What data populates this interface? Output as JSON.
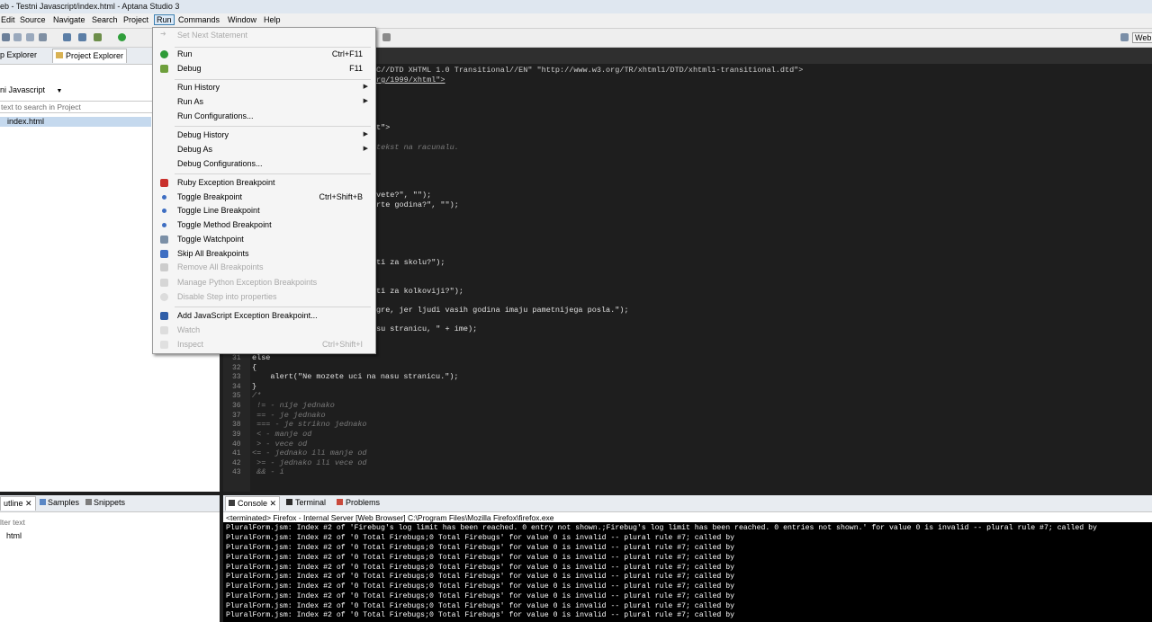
{
  "window": {
    "title": "eb - Testni Javascript/index.html - Aptana Studio 3"
  },
  "menubar": {
    "items": [
      "Edit",
      "Source",
      "Navigate",
      "Search",
      "Project",
      "Run",
      "Commands",
      "Window",
      "Help"
    ],
    "active": "Run"
  },
  "toolbar": {
    "web_label": "Web"
  },
  "left_panel": {
    "tabs": [
      "p Explorer",
      "Project Explorer"
    ],
    "project_selector": "ni Javascript",
    "search_placeholder": "text to search in Project",
    "tree": [
      {
        "label": "index.html",
        "selected": true
      }
    ]
  },
  "outline_panel": {
    "tabs": [
      "utline",
      "Samples",
      "Snippets"
    ],
    "filter_placeholder": "lter text",
    "tree": [
      {
        "label": "html"
      }
    ]
  },
  "editor": {
    "top_lines": [
      "C//DTD XHTML 1.0 Transitional//EN\" \"http://www.w3.org/TR/xhtml1/DTD/xhtml1-transitional.dtd\">",
      "rg/1999/xhtml\">"
    ],
    "mid_lines": [
      {
        "text": "t\">",
        "dim": false
      },
      {
        "text": "tekst na racunalu.",
        "dim": true
      },
      {
        "text": "vete?\", \"\");",
        "dim": false
      },
      {
        "text": "rte godina?\", \"\");",
        "dim": false
      },
      {
        "text": "ti za skolu?\");",
        "dim": false
      },
      {
        "text": "ti za kolkoviji?\");",
        "dim": false
      },
      {
        "text": "gre, jer ljudi vasih godina imaju pametnijega posla.\");",
        "dim": false
      },
      {
        "text": "su stranicu, \" + ime);",
        "dim": false
      }
    ],
    "numbered_lines": [
      {
        "n": "31",
        "text": "else",
        "dim": false
      },
      {
        "n": "32",
        "text": "{",
        "dim": false
      },
      {
        "n": "33",
        "text": "    alert(\"Ne mozete uci na nasu stranicu.\");",
        "dim": false
      },
      {
        "n": "34",
        "text": "}",
        "dim": false
      },
      {
        "n": "35",
        "text": "/*",
        "dim": true
      },
      {
        "n": "36",
        "text": " != - nije jednako",
        "dim": true
      },
      {
        "n": "37",
        "text": " == - je jednako",
        "dim": true
      },
      {
        "n": "38",
        "text": " === - je strikno jednako",
        "dim": true
      },
      {
        "n": "39",
        "text": " < - manje od",
        "dim": true
      },
      {
        "n": "40",
        "text": " > - vece od",
        "dim": true
      },
      {
        "n": "41",
        "text": "<= - jednako ili manje od",
        "dim": true
      },
      {
        "n": "42",
        "text": " >= - jednako ili vece od",
        "dim": true
      },
      {
        "n": "43",
        "text": " && - i",
        "dim": true
      }
    ]
  },
  "console": {
    "tabs": [
      "Console",
      "Terminal",
      "Problems"
    ],
    "header": "<terminated> Firefox - Internal Server [Web Browser] C:\\Program Files\\Mozilla Firefox\\firefox.exe",
    "first_line": "PluralForm.jsm: Index #2 of 'Firebug's log limit has been reached. 0 entry not shown.;Firebug's log limit has been reached. 0 entries not shown.' for value 0 is invalid -- plural rule #7; called by",
    "repeat_line": "PluralForm.jsm: Index #2 of '0 Total Firebugs;0 Total Firebugs' for value 0 is invalid -- plural rule #7; called by",
    "repeat_count": 9
  },
  "run_menu": {
    "items": [
      {
        "label": "Set Next Statement",
        "shortcut": "",
        "disabled": true,
        "submenu": false,
        "icon": "arrow-icon"
      },
      {
        "sep": true
      },
      {
        "label": "Run",
        "shortcut": "Ctrl+F11",
        "disabled": false,
        "submenu": false,
        "icon": "run-icon"
      },
      {
        "label": "Debug",
        "shortcut": "F11",
        "disabled": false,
        "submenu": false,
        "icon": "debug-icon"
      },
      {
        "sep": true
      },
      {
        "label": "Run History",
        "shortcut": "",
        "disabled": false,
        "submenu": true
      },
      {
        "label": "Run As",
        "shortcut": "",
        "disabled": false,
        "submenu": true
      },
      {
        "label": "Run Configurations...",
        "shortcut": "",
        "disabled": false,
        "submenu": false
      },
      {
        "sep": true
      },
      {
        "label": "Debug History",
        "shortcut": "",
        "disabled": false,
        "submenu": true
      },
      {
        "label": "Debug As",
        "shortcut": "",
        "disabled": false,
        "submenu": true
      },
      {
        "label": "Debug Configurations...",
        "shortcut": "",
        "disabled": false,
        "submenu": false
      },
      {
        "sep": true
      },
      {
        "label": "Ruby Exception Breakpoint",
        "shortcut": "",
        "disabled": false,
        "submenu": false,
        "icon": "breakpoint-icon"
      },
      {
        "label": "Toggle Breakpoint",
        "shortcut": "Ctrl+Shift+B",
        "disabled": false,
        "submenu": false,
        "icon": "breakpoint-icon"
      },
      {
        "label": "Toggle Line Breakpoint",
        "shortcut": "",
        "disabled": false,
        "submenu": false,
        "icon": "breakpoint-icon"
      },
      {
        "label": "Toggle Method Breakpoint",
        "shortcut": "",
        "disabled": false,
        "submenu": false,
        "icon": "breakpoint-icon"
      },
      {
        "label": "Toggle Watchpoint",
        "shortcut": "",
        "disabled": false,
        "submenu": false,
        "icon": "watchpoint-icon"
      },
      {
        "label": "Skip All Breakpoints",
        "shortcut": "",
        "disabled": false,
        "submenu": false,
        "icon": "skip-breakpoints-icon"
      },
      {
        "label": "Remove All Breakpoints",
        "shortcut": "",
        "disabled": true,
        "submenu": false,
        "icon": "remove-breakpoints-icon"
      },
      {
        "label": "Manage Python Exception Breakpoints",
        "shortcut": "",
        "disabled": true,
        "submenu": false,
        "icon": "python-icon"
      },
      {
        "label": "Disable Step into properties",
        "shortcut": "",
        "disabled": true,
        "submenu": false,
        "icon": "step-icon"
      },
      {
        "sep": true
      },
      {
        "label": "Add JavaScript Exception Breakpoint...",
        "shortcut": "",
        "disabled": false,
        "submenu": false,
        "icon": "js-exception-icon"
      },
      {
        "label": "Watch",
        "shortcut": "",
        "disabled": true,
        "submenu": false,
        "icon": "watch-icon"
      },
      {
        "label": "Inspect",
        "shortcut": "Ctrl+Shift+I",
        "disabled": true,
        "submenu": false,
        "icon": "inspect-icon"
      }
    ]
  },
  "colors": {
    "accent": "#3c7fb1",
    "editor_bg": "#1e1e1e",
    "console_bg": "#000000",
    "menu_bg": "#f5f5f5"
  }
}
